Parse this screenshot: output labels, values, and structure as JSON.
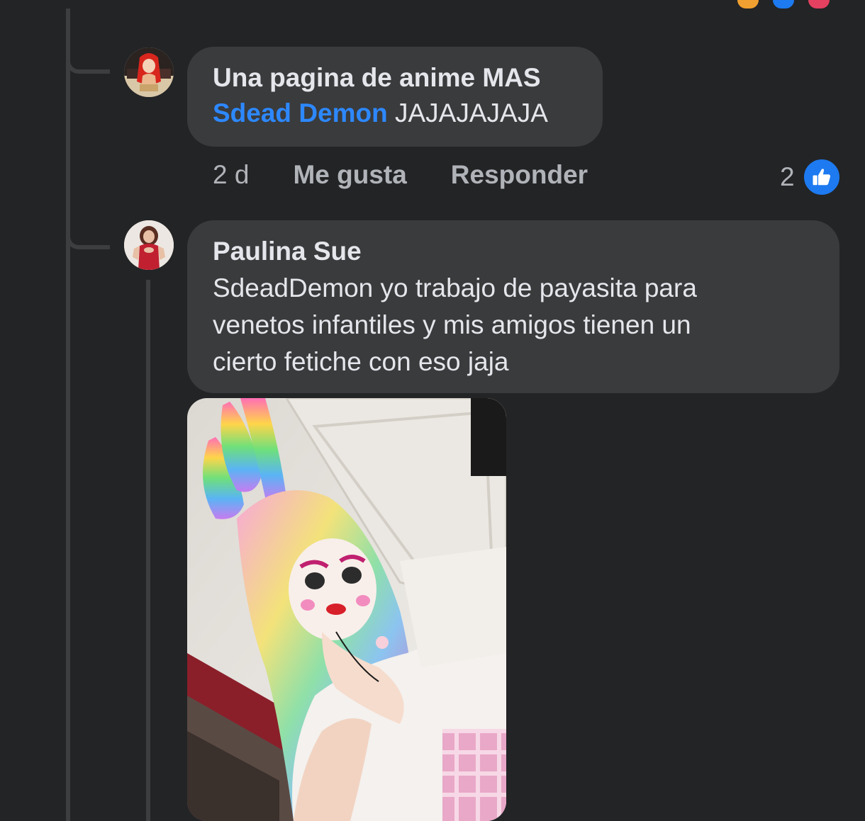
{
  "colors": {
    "background": "#232426",
    "bubble": "#3a3b3c",
    "text": "#e4e6eb",
    "muted": "#b0b3b8",
    "mention": "#2d88ff",
    "like_blue": "#1d7af0"
  },
  "comments": [
    {
      "author": "Una pagina de anime MAS",
      "mention": "Sdead Demon",
      "text": "JAJAJAJAJA",
      "time": "2 d",
      "like_label": "Me gusta",
      "reply_label": "Responder",
      "reaction_count": "2",
      "reaction_icon": "thumbs-up-icon",
      "avatar_icon": "anime-page-avatar"
    },
    {
      "author": "Paulina Sue",
      "text_lines": [
        "SdeadDemon yo trabajo de payasita para",
        "venetos infantiles y mis amigos tienen un",
        "cierto fetiche con eso jaja"
      ],
      "avatar_icon": "user-avatar",
      "photo": "clown-costume-selfie-photo"
    }
  ]
}
